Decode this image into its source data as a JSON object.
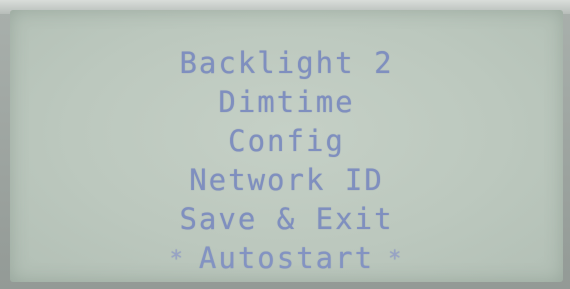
{
  "menu": {
    "items": [
      {
        "label": "Backlight 2"
      },
      {
        "label": "Dimtime"
      },
      {
        "label": "Config"
      },
      {
        "label": "Network ID"
      },
      {
        "label": "Save & Exit"
      },
      {
        "label": "Autostart",
        "marker_left": "*",
        "marker_right": "*",
        "selected": true
      }
    ]
  },
  "colors": {
    "lcd_background": "#bcc8be",
    "text": "#7f8fbf"
  }
}
